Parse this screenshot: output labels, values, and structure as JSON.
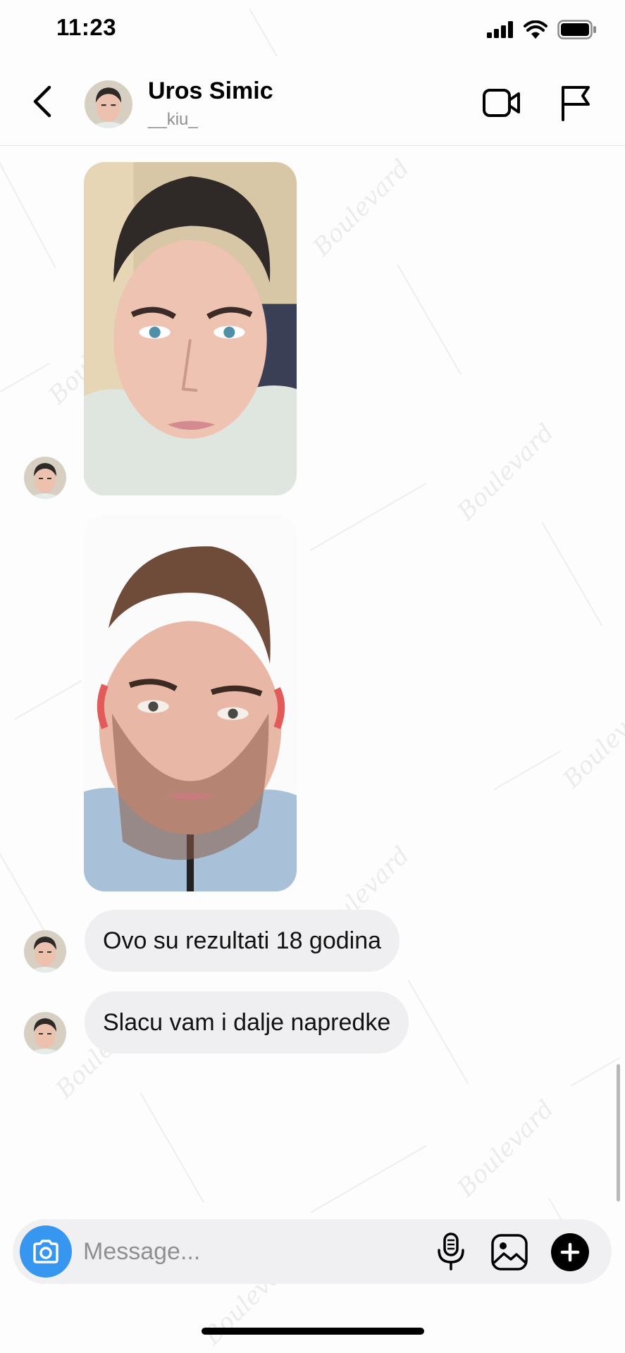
{
  "status_bar": {
    "time": "11:23",
    "icons": [
      "cellular-signal-icon",
      "wifi-icon",
      "battery-icon"
    ]
  },
  "header": {
    "contact_name": "Uros Simic",
    "username": "__kiu_",
    "icons": [
      "back-chevron-icon",
      "video-camera-icon",
      "flag-icon"
    ]
  },
  "messages": [
    {
      "type": "photo",
      "description_icon": "selfie-photo"
    },
    {
      "type": "photo",
      "description_icon": "selfie-photo"
    },
    {
      "type": "text",
      "text": "Ovo su rezultati 18 godina"
    },
    {
      "type": "text",
      "text": "Slacu vam i dalje napredke"
    }
  ],
  "composer": {
    "placeholder": "Message...",
    "icons": [
      "camera-icon",
      "microphone-icon",
      "gallery-icon",
      "plus-icon"
    ]
  },
  "colors": {
    "accent_blue": "#3797f0",
    "bubble_gray": "#efeff1",
    "background": "#fdfdfe"
  }
}
